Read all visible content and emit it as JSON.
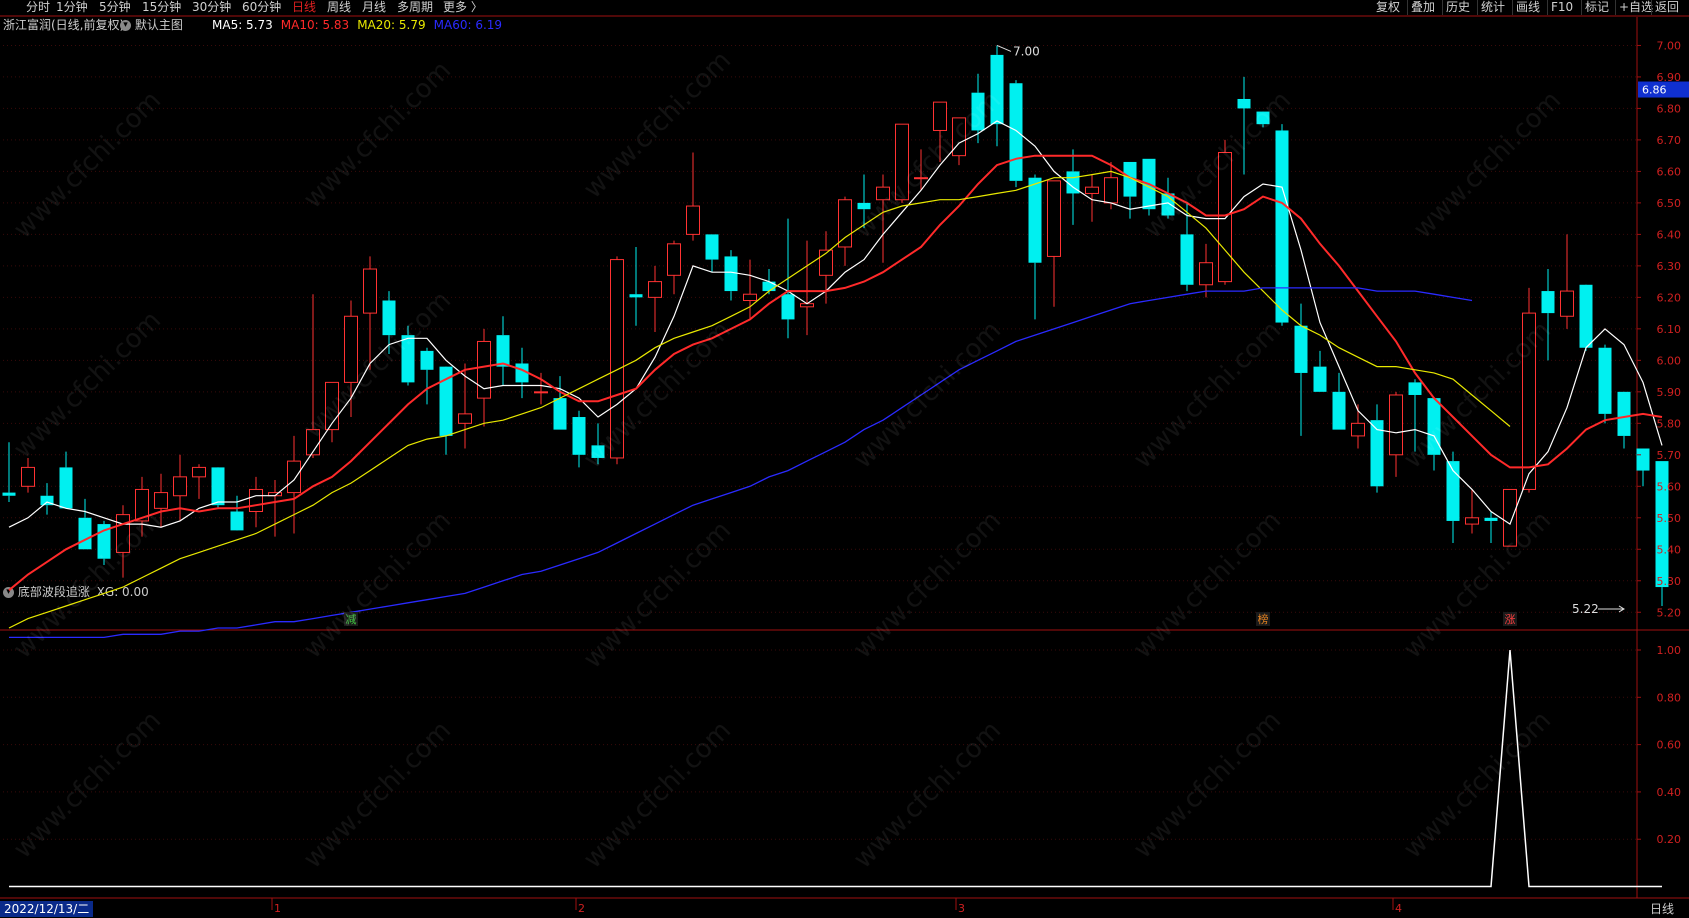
{
  "toolbar": {
    "left": [
      "分时",
      "1分钟",
      "5分钟",
      "15分钟",
      "30分钟",
      "60分钟",
      "日线",
      "周线",
      "月线",
      "多周期",
      "更多 〉"
    ],
    "active": "日线",
    "right": [
      "复权",
      "叠加",
      "历史",
      "统计",
      "画线",
      "F10",
      "标记",
      "+自选",
      "返回"
    ]
  },
  "legend": {
    "stock": "浙江富润(日线,前复权)",
    "main_chart_label": "默认主图",
    "ma": [
      {
        "label": "MA5: 5.73",
        "color": "#ffffff"
      },
      {
        "label": "MA10: 5.83",
        "color": "#ff2a2a"
      },
      {
        "label": "MA20: 5.79",
        "color": "#e8e800"
      },
      {
        "label": "MA60: 6.19",
        "color": "#2a2aff"
      }
    ]
  },
  "indicator": {
    "name": "底部波段追涨",
    "value_label": "XG: 0.00"
  },
  "current_price": "6.86",
  "bottom": {
    "date": "2022/12/13/二",
    "period": "日线"
  },
  "watermark_text": "www.cfchi.com",
  "chart_data": [
    {
      "type": "candlestick",
      "title": "浙江富润(日线,前复权)",
      "y_ticks": [
        "7.00",
        "6.90",
        "6.80",
        "6.70",
        "6.60",
        "6.50",
        "6.40",
        "6.30",
        "6.20",
        "6.10",
        "6.00",
        "5.90",
        "5.80",
        "5.70",
        "5.60",
        "5.50",
        "5.40",
        "5.30",
        "5.20"
      ],
      "ylim": [
        5.15,
        7.03
      ],
      "x_month_labels": [
        {
          "label": "1",
          "index": 14
        },
        {
          "label": "2",
          "index": 30
        },
        {
          "label": "3",
          "index": 50
        },
        {
          "label": "4",
          "index": 73
        }
      ],
      "annotations": [
        {
          "text": "7.00",
          "index": 52,
          "value": 7.0,
          "kind": "high"
        },
        {
          "text": "5.22",
          "index": 85,
          "value": 5.22,
          "kind": "low"
        }
      ],
      "markers": [
        {
          "text": "减",
          "index": 18,
          "color": "#40c040"
        },
        {
          "text": "榜",
          "index": 66,
          "color": "#e08020"
        },
        {
          "text": "涨",
          "index": 79,
          "color": "#ff4040"
        }
      ],
      "ohlc": [
        [
          5.58,
          5.74,
          5.55,
          5.57
        ],
        [
          5.6,
          5.69,
          5.58,
          5.66
        ],
        [
          5.57,
          5.61,
          5.51,
          5.54
        ],
        [
          5.66,
          5.71,
          5.57,
          5.53
        ],
        [
          5.5,
          5.56,
          5.4,
          5.4
        ],
        [
          5.48,
          5.49,
          5.35,
          5.37
        ],
        [
          5.39,
          5.54,
          5.31,
          5.51
        ],
        [
          5.49,
          5.63,
          5.44,
          5.59
        ],
        [
          5.53,
          5.64,
          5.47,
          5.58
        ],
        [
          5.57,
          5.7,
          5.49,
          5.63
        ],
        [
          5.63,
          5.67,
          5.56,
          5.66
        ],
        [
          5.66,
          5.64,
          5.53,
          5.54
        ],
        [
          5.52,
          5.57,
          5.47,
          5.46
        ],
        [
          5.52,
          5.63,
          5.47,
          5.59
        ],
        [
          5.57,
          5.62,
          5.44,
          5.58
        ],
        [
          5.58,
          5.76,
          5.45,
          5.68
        ],
        [
          5.7,
          6.21,
          5.69,
          5.78
        ],
        [
          5.78,
          5.9,
          5.74,
          5.93
        ],
        [
          5.93,
          6.19,
          5.82,
          6.14
        ],
        [
          6.15,
          6.33,
          5.97,
          6.29
        ],
        [
          6.19,
          6.22,
          6.02,
          6.08
        ],
        [
          6.08,
          6.11,
          5.92,
          5.93
        ],
        [
          6.03,
          6.04,
          5.86,
          5.97
        ],
        [
          5.98,
          5.96,
          5.7,
          5.76
        ],
        [
          5.8,
          5.99,
          5.72,
          5.83
        ],
        [
          5.88,
          6.1,
          5.79,
          6.06
        ],
        [
          6.08,
          6.14,
          5.92,
          5.98
        ],
        [
          5.99,
          6.04,
          5.88,
          5.93
        ],
        [
          5.9,
          5.96,
          5.86,
          5.9
        ],
        [
          5.88,
          5.95,
          5.78,
          5.78
        ],
        [
          5.82,
          5.84,
          5.66,
          5.7
        ],
        [
          5.73,
          5.8,
          5.67,
          5.69
        ],
        [
          5.69,
          6.33,
          5.67,
          6.32
        ],
        [
          6.21,
          6.36,
          6.11,
          6.2
        ],
        [
          6.2,
          6.3,
          6.09,
          6.25
        ],
        [
          6.27,
          6.38,
          6.21,
          6.37
        ],
        [
          6.4,
          6.66,
          6.38,
          6.49
        ],
        [
          6.4,
          6.4,
          6.28,
          6.32
        ],
        [
          6.33,
          6.35,
          6.19,
          6.22
        ],
        [
          6.19,
          6.32,
          6.13,
          6.21
        ],
        [
          6.25,
          6.29,
          6.21,
          6.22
        ],
        [
          6.21,
          6.45,
          6.07,
          6.13
        ],
        [
          6.17,
          6.38,
          6.08,
          6.18
        ],
        [
          6.27,
          6.41,
          6.18,
          6.35
        ],
        [
          6.36,
          6.52,
          6.3,
          6.51
        ],
        [
          6.5,
          6.59,
          6.42,
          6.48
        ],
        [
          6.51,
          6.59,
          6.31,
          6.55
        ],
        [
          6.51,
          6.75,
          6.5,
          6.75
        ],
        [
          6.58,
          6.67,
          6.54,
          6.58
        ],
        [
          6.73,
          6.78,
          6.63,
          6.82
        ],
        [
          6.65,
          6.73,
          6.62,
          6.77
        ],
        [
          6.85,
          6.91,
          6.69,
          6.73
        ],
        [
          6.97,
          7.0,
          6.68,
          6.75
        ],
        [
          6.88,
          6.89,
          6.55,
          6.57
        ],
        [
          6.58,
          6.59,
          6.13,
          6.31
        ],
        [
          6.33,
          6.34,
          6.17,
          6.57
        ],
        [
          6.6,
          6.67,
          6.43,
          6.53
        ],
        [
          6.53,
          6.59,
          6.44,
          6.55
        ],
        [
          6.5,
          6.63,
          6.48,
          6.58
        ],
        [
          6.63,
          6.57,
          6.45,
          6.52
        ],
        [
          6.64,
          6.64,
          6.46,
          6.48
        ],
        [
          6.53,
          6.58,
          6.45,
          6.46
        ],
        [
          6.4,
          6.5,
          6.22,
          6.24
        ],
        [
          6.24,
          6.37,
          6.2,
          6.31
        ],
        [
          6.25,
          6.7,
          6.24,
          6.66
        ],
        [
          6.83,
          6.9,
          6.59,
          6.8
        ],
        [
          6.79,
          6.77,
          6.74,
          6.75
        ],
        [
          6.73,
          6.75,
          6.11,
          6.12
        ],
        [
          6.11,
          6.18,
          5.76,
          5.96
        ],
        [
          5.98,
          6.03,
          5.9,
          5.9
        ],
        [
          5.9,
          5.96,
          5.78,
          5.78
        ],
        [
          5.76,
          5.86,
          5.72,
          5.8
        ],
        [
          5.81,
          5.86,
          5.58,
          5.6
        ],
        [
          5.7,
          5.9,
          5.63,
          5.89
        ],
        [
          5.93,
          5.94,
          5.71,
          5.89
        ],
        [
          5.88,
          5.81,
          5.65,
          5.7
        ],
        [
          5.68,
          5.71,
          5.42,
          5.49
        ],
        [
          5.48,
          5.59,
          5.45,
          5.5
        ],
        [
          5.5,
          5.52,
          5.42,
          5.49
        ],
        [
          5.41,
          5.56,
          5.41,
          5.59
        ],
        [
          5.59,
          6.23,
          5.58,
          6.15
        ],
        [
          6.22,
          6.29,
          6.0,
          6.15
        ],
        [
          6.14,
          6.4,
          6.1,
          6.22
        ],
        [
          6.24,
          6.2,
          6.03,
          6.04
        ],
        [
          6.04,
          6.05,
          5.8,
          5.83
        ],
        [
          5.9,
          5.86,
          5.72,
          5.76
        ],
        [
          5.72,
          5.7,
          5.6,
          5.65
        ],
        [
          5.68,
          5.68,
          5.22,
          5.28
        ]
      ],
      "ma_series": [
        {
          "name": "MA5",
          "color": "#ffffff",
          "values": [
            5.47,
            5.5,
            5.55,
            5.53,
            5.52,
            5.5,
            5.48,
            5.48,
            5.47,
            5.49,
            5.53,
            5.55,
            5.55,
            5.57,
            5.57,
            5.62,
            5.71,
            5.8,
            5.88,
            5.99,
            6.05,
            6.07,
            6.07,
            6.0,
            5.95,
            5.91,
            5.92,
            5.92,
            5.92,
            5.91,
            5.88,
            5.82,
            5.86,
            5.91,
            6.01,
            6.14,
            6.3,
            6.28,
            6.28,
            6.27,
            6.25,
            6.22,
            6.18,
            6.22,
            6.28,
            6.32,
            6.4,
            6.47,
            6.54,
            6.62,
            6.69,
            6.72,
            6.76,
            6.73,
            6.68,
            6.6,
            6.55,
            6.51,
            6.5,
            6.48,
            6.49,
            6.5,
            6.46,
            6.45,
            6.45,
            6.52,
            6.56,
            6.55,
            6.35,
            6.12,
            5.98,
            5.84,
            5.78,
            5.77,
            5.78,
            5.76,
            5.65,
            5.59,
            5.52,
            5.48,
            5.64,
            5.71,
            5.85,
            6.04,
            6.1,
            6.05,
            5.93,
            5.73
          ]
        },
        {
          "name": "MA10",
          "color": "#ff2a2a",
          "values": [
            5.27,
            5.32,
            5.36,
            5.4,
            5.43,
            5.46,
            5.48,
            5.5,
            5.52,
            5.53,
            5.52,
            5.53,
            5.53,
            5.54,
            5.55,
            5.56,
            5.6,
            5.63,
            5.68,
            5.74,
            5.8,
            5.86,
            5.91,
            5.94,
            5.97,
            5.98,
            5.99,
            5.97,
            5.94,
            5.9,
            5.87,
            5.87,
            5.89,
            5.91,
            5.97,
            6.02,
            6.05,
            6.07,
            6.1,
            6.13,
            6.18,
            6.22,
            6.22,
            6.22,
            6.23,
            6.25,
            6.28,
            6.32,
            6.36,
            6.43,
            6.49,
            6.56,
            6.62,
            6.64,
            6.65,
            6.65,
            6.65,
            6.65,
            6.62,
            6.58,
            6.56,
            6.53,
            6.5,
            6.46,
            6.46,
            6.48,
            6.52,
            6.5,
            6.45,
            6.37,
            6.3,
            6.22,
            6.14,
            6.06,
            5.96,
            5.88,
            5.82,
            5.76,
            5.7,
            5.66,
            5.66,
            5.67,
            5.72,
            5.78,
            5.81,
            5.82,
            5.83,
            5.82
          ]
        },
        {
          "name": "MA20",
          "color": "#e8e800",
          "values": [
            5.15,
            5.18,
            5.2,
            5.22,
            5.24,
            5.26,
            5.28,
            5.31,
            5.34,
            5.37,
            5.39,
            5.41,
            5.43,
            5.45,
            5.48,
            5.51,
            5.54,
            5.58,
            5.61,
            5.65,
            5.69,
            5.73,
            5.75,
            5.76,
            5.78,
            5.8,
            5.81,
            5.83,
            5.85,
            5.88,
            5.91,
            5.94,
            5.97,
            6.0,
            6.04,
            6.07,
            6.09,
            6.11,
            6.14,
            6.17,
            6.22,
            6.26,
            6.3,
            6.34,
            6.39,
            6.43,
            6.47,
            6.49,
            6.5,
            6.51,
            6.51,
            6.52,
            6.53,
            6.54,
            6.56,
            6.58,
            6.58,
            6.59,
            6.6,
            6.58,
            6.55,
            6.52,
            6.47,
            6.42,
            6.35,
            6.28,
            6.22,
            6.16,
            6.11,
            6.08,
            6.04,
            6.01,
            5.98,
            5.98,
            5.97,
            5.96,
            5.94,
            5.89,
            5.84,
            5.79
          ]
        },
        {
          "name": "MA60",
          "color": "#2a2aff",
          "values": [
            5.12,
            5.12,
            5.12,
            5.12,
            5.12,
            5.12,
            5.13,
            5.13,
            5.13,
            5.14,
            5.14,
            5.15,
            5.15,
            5.16,
            5.17,
            5.17,
            5.18,
            5.19,
            5.2,
            5.21,
            5.22,
            5.23,
            5.24,
            5.25,
            5.26,
            5.28,
            5.3,
            5.32,
            5.33,
            5.35,
            5.37,
            5.39,
            5.42,
            5.45,
            5.48,
            5.51,
            5.54,
            5.56,
            5.58,
            5.6,
            5.63,
            5.65,
            5.68,
            5.71,
            5.74,
            5.78,
            5.81,
            5.85,
            5.89,
            5.93,
            5.97,
            6.0,
            6.03,
            6.06,
            6.08,
            6.1,
            6.12,
            6.14,
            6.16,
            6.18,
            6.19,
            6.2,
            6.21,
            6.22,
            6.22,
            6.22,
            6.23,
            6.23,
            6.23,
            6.23,
            6.23,
            6.23,
            6.22,
            6.22,
            6.22,
            6.21,
            6.2,
            6.19
          ]
        }
      ]
    },
    {
      "type": "line",
      "title": "底部波段追涨",
      "series": [
        {
          "name": "XG",
          "color": "#ffffff",
          "values": [
            0,
            0,
            0,
            0,
            0,
            0,
            0,
            0,
            0,
            0,
            0,
            0,
            0,
            0,
            0,
            0,
            0,
            0,
            0,
            0,
            0,
            0,
            0,
            0,
            0,
            0,
            0,
            0,
            0,
            0,
            0,
            0,
            0,
            0,
            0,
            0,
            0,
            0,
            0,
            0,
            0,
            0,
            0,
            0,
            0,
            0,
            0,
            0,
            0,
            0,
            0,
            0,
            0,
            0,
            0,
            0,
            0,
            0,
            0,
            0,
            0,
            0,
            0,
            0,
            0,
            0,
            0,
            0,
            0,
            0,
            0,
            0,
            0,
            0,
            0,
            0,
            0,
            0,
            0,
            1,
            0,
            0,
            0,
            0,
            0,
            0,
            0,
            0
          ]
        }
      ],
      "y_ticks": [
        "1.00",
        "0.80",
        "0.60",
        "0.40",
        "0.20"
      ],
      "ylim": [
        -0.04,
        1.0
      ]
    }
  ]
}
